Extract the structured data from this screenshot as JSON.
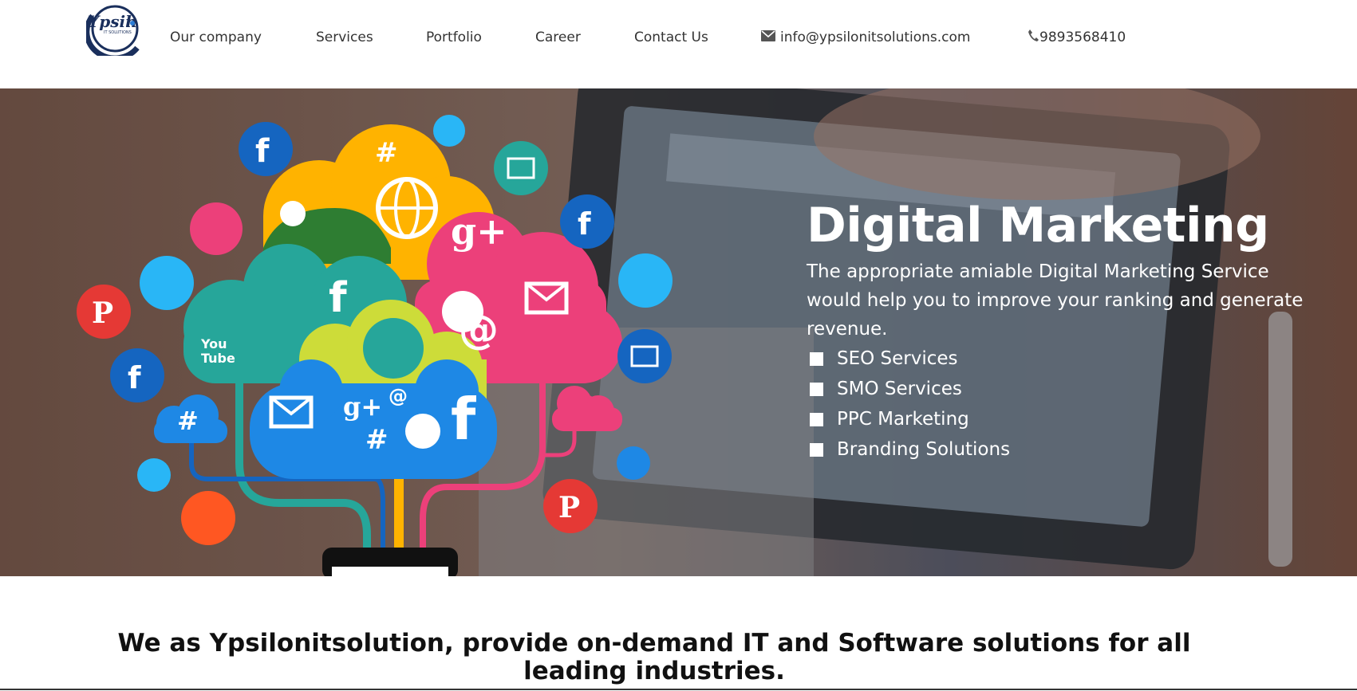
{
  "logo": {
    "text": "Ypsilon",
    "subtext": "IT SOLUTIONS"
  },
  "nav": {
    "items": [
      {
        "label": "Our company"
      },
      {
        "label": "Services"
      },
      {
        "label": "Portfolio"
      },
      {
        "label": "Career"
      },
      {
        "label": "Contact Us"
      }
    ],
    "email": "info@ypsilonitsolutions.com",
    "phone": "9893568410",
    "email_icon": "envelope-icon",
    "phone_icon": "phone-icon"
  },
  "hero": {
    "title": "Digital Marketing",
    "description": "The appropriate amiable Digital Marketing Service would help you to improve your ranking and generate revenue.",
    "services": [
      "SEO Services",
      "SMO Services",
      "PPC Marketing",
      "Branding Solutions"
    ]
  },
  "tagline": "We as Ypsilonitsolution, provide on-demand IT and Software solutions for all leading industries.",
  "colors": {
    "facebook": "#1565c0",
    "twitter": "#29b6f6",
    "pink": "#ec407a",
    "teal": "#26a69a",
    "orange": "#ff5722",
    "yellow": "#ffb300",
    "green": "#2e7d32"
  }
}
